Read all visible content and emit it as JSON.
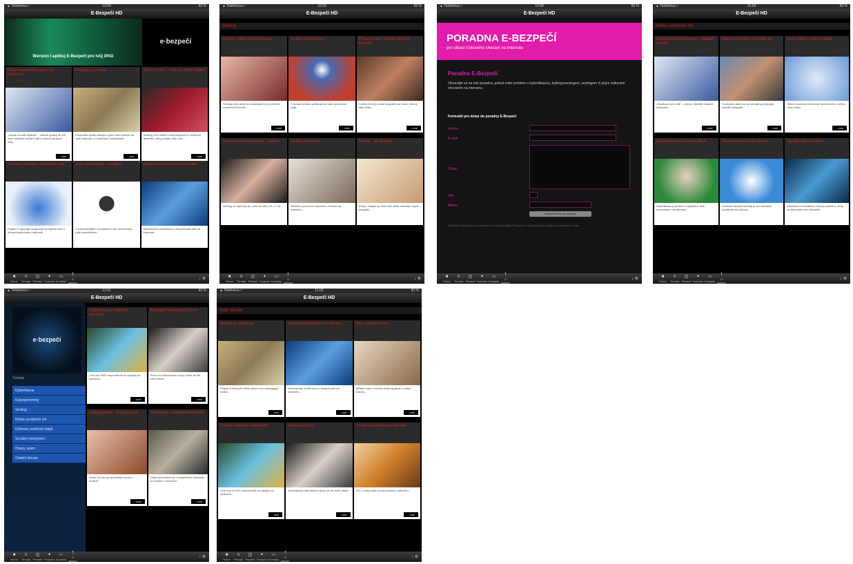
{
  "app": {
    "title": "E-Bezpečí HD",
    "status_carrier": "▲ Telefonica ≈",
    "status_battery": "83 %",
    "more_label": "...více",
    "tabs": [
      {
        "label": "Home",
        "icon": "■"
      },
      {
        "label": "Témata",
        "icon": "≡"
      },
      {
        "label": "Partneři",
        "icon": "◫"
      },
      {
        "label": "Poradna",
        "icon": "✦"
      },
      {
        "label": "Kontakty",
        "icon": "▭"
      },
      {
        "label": "O aplikaci",
        "icon": "†"
      }
    ],
    "tools_icon": "↓ ⚙"
  },
  "screens": [
    {
      "clock": "10:54",
      "banner_text": "Wersion I aplikuj E-Bezpečí pro tvůj iPAD",
      "logo_text": "e·bezpečí",
      "cards": [
        {
          "title": "Pozor na podvodné zprávy na Facebooku",
          "text": "„Zkuste si tuhle aplikaci“ – takové zprávy se šíří mezi uživateli sociální sítě a zneužívají jejich účty..."
        },
        {
          "title": "Podvody na e-mailu",
          "text": "Podvodné zprávy slibující výhru nebo peníze se opět objevují v e-mailových schránkách..."
        },
        {
          "title": "Jak na sexting – rizika pro děti a mládež",
          "text": "Sexting mezi dětmi a dospívajícími je rozšířený fenomén, který přináší řadu rizik..."
        },
        {
          "title": "Projekt E-Synergie – spolupráce škol",
          "text": "Projekt E-Synergie podporuje spolupráci škol v oblasti bezpečného internetu..."
        },
        {
          "title": "Dítě a kyberšikana – co dělat?",
          "text": "K nejzávažnějším problémům dětí na internetu patří kyberšikana..."
        },
        {
          "title": "Bezpečnost na internetu pro rodiče",
          "text": "Mezinárodní konference o bezpečnosti dětí na internetu..."
        }
      ]
    },
    {
      "clock": "10:56",
      "section": "Sexting",
      "cards": [
        {
          "title": "Sexting – rizika sdílení fotografií",
          "text": "Sexting mezi dětmi a dospívajícími je poměrně rozšířený fenomén..."
        },
        {
          "title": "Sexting a kyberšikana",
          "text": "K tomuto tématu publikujeme další výzkumná data..."
        },
        {
          "title": "Případ z praxe: zneužití intimních fotografií",
          "text": "Tomáš (16 let) poslal fotografii své dívce, která ji dále šířila..."
        },
        {
          "title": "Sexting mezi dospívajícími – výzkum",
          "text": "Sexting se objevuje již u dětí ve věku 12–17 let..."
        },
        {
          "title": "Sexting a prevence",
          "text": "Efektivní prevence rizikového chování na internetu..."
        },
        {
          "title": "Sexting – jak se bránit",
          "text": "Dívky i chlapci by měli znát rizika odesílání svých fotografií..."
        }
      ]
    },
    {
      "clock": "10:58",
      "banner_title": "PORADNA E-BEZPEČÍ",
      "banner_sub": "pro oblast rizikového chování na internetu",
      "heading": "Poradna E-Bezpečí",
      "intro": "Obracejte se na tuto poradnu, pokud máte problém s kyberšikanou, kybergroomingem, sextingem či jiným rizikovým chováním na internetu.",
      "form_title": "Formulář pro dotaz do poradny E-Bezpečí",
      "fields": [
        "Jméno",
        "E-mail",
        "Dotaz",
        "Věk",
        "Město"
      ],
      "submit": "Odeslat dotaz do poradny",
      "footer": "Poradna E-Bezpečí je provozována v rámci projektu E-Bezpečí. Odpovědi jsou zasílány na uvedený e-mail."
    },
    {
      "clock": "10:59",
      "section": "Rizika sociálních sítí",
      "cards": [
        {
          "title": "Bezpečnost na Facebooku – základní pravidla",
          "text": "„Facebook bez rizik“ – proč je důležité nastavit soukromí..."
        },
        {
          "title": "Zneužití fotografie na sociální síti",
          "text": "V poslední době se na síti objevují případy zneužití fotografií..."
        },
        {
          "title": "Rizika sdílení osobních údajů",
          "text": "Sdílení osobních informací na internetu s sebou nese rizika..."
        },
        {
          "title": "Kyberšikana na sociálních sítích",
          "text": "Kyberšikana je jedním z největších rizik komunikace na internetu..."
        },
        {
          "title": "Virtuální identita a její ochrana",
          "text": "Ochrana virtuální identity je pro uživatele sociálních sítí klíčová..."
        },
        {
          "title": "Sociální sítě a závislost",
          "text": "Závislost na sociálních sítích je problém, který se týká stále více uživatelů..."
        }
      ]
    },
    {
      "clock": "11:01",
      "logo_text": "e·bezpečí",
      "menu_heading": "Témata",
      "menu": [
        "Kyberšikana",
        "Kybergrooming",
        "Sexting",
        "Rizika sociálních sítí",
        "Ochrana osobních údajů",
        "Sociální inženýrství",
        "Hoaxy, spam",
        "Ostatní témata"
      ],
      "cards": [
        {
          "title": "Kyberšikana na mobilních telefonech",
          "text": "Více než 3000 respondentů se zapojilo do výzkumu..."
        },
        {
          "title": "Nebezpečí internetových výzev",
          "text": "Pozor na nebezpečné výzvy, které se šíří mezi dětmi..."
        },
        {
          "title": "Kybergrooming – případ z praxe",
          "text": "Dívka (14 let) se seznámila na síti s mužem..."
        },
        {
          "title": "Konference o bezpečném internetu",
          "text": "Odborná konference o bezpečném internetu se konala v Olomouci..."
        }
      ]
    },
    {
      "clock": "11:03",
      "section": "Další témata",
      "cards": [
        {
          "title": "Školení pro pedagogy",
          "text": "Projekt E-Bezpečí nabízí školení pro pedagogy i rodiče..."
        },
        {
          "title": "Internetová bezpečnost ve školách",
          "text": "Mezinárodní konference o bezpečnosti na internetu..."
        },
        {
          "title": "Děti a počítačové hry",
          "text": "Dětské hráče ohrožují rizika spojená s online hraním..."
        },
        {
          "title": "Výzkum rizikového chování dětí",
          "text": "Více než 20 000 respondentů se zapojilo do výzkumu..."
        },
        {
          "title": "Internetové výzvy",
          "text": "Nebezpečné internetové výzvy se šíří mezi dětmi..."
        },
        {
          "title": "Trestní odpovědnost na internetu",
          "text": "Od 1. ledna platí novela trestního zákoníku..."
        }
      ]
    }
  ],
  "colors": {
    "accent_red": "#e02020",
    "pink": "#e21cab",
    "menu_blue": "#1d56b0"
  }
}
